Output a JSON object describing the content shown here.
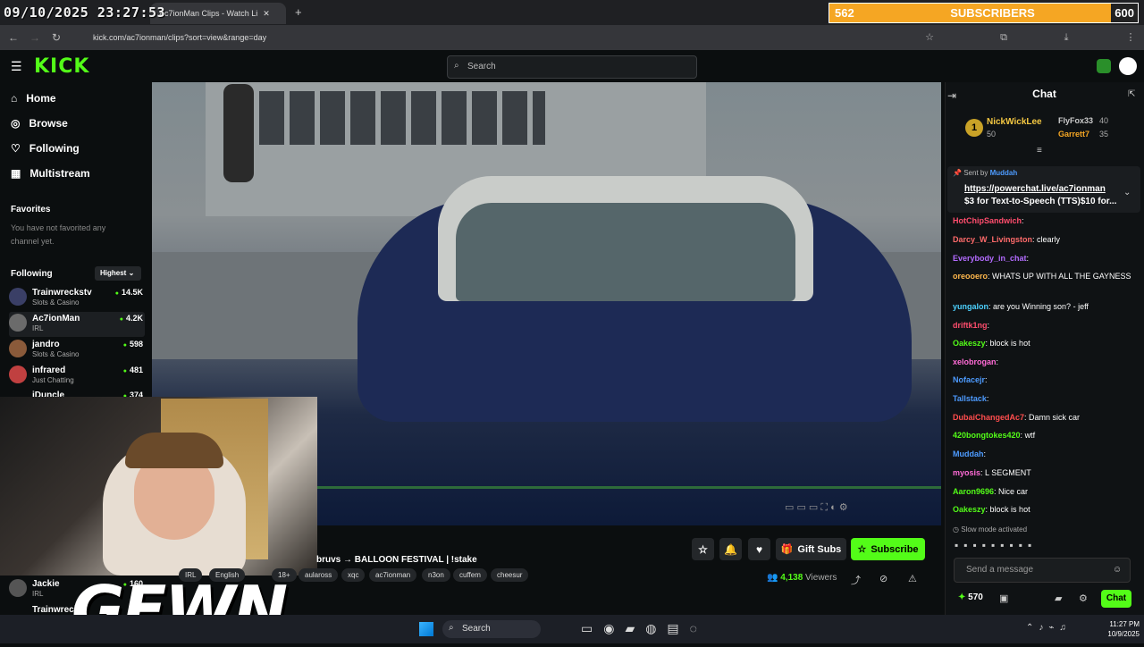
{
  "overlay": {
    "timestamp": "09/10/2025 23:27:53",
    "subs_current": "562",
    "subs_label": "SUBSCRIBERS",
    "subs_goal": "600",
    "watermark": "GEWN"
  },
  "browser": {
    "tab_title": "Ac7ionMan Clips - Watch Li",
    "url": "kick.com/ac7ionman/clips?sort=view&range=day"
  },
  "header": {
    "logo": "KICK",
    "search_placeholder": "Search"
  },
  "sidebar": {
    "nav": [
      {
        "label": "Home",
        "icon": "home-icon"
      },
      {
        "label": "Browse",
        "icon": "compass-icon"
      },
      {
        "label": "Following",
        "icon": "heart-icon"
      },
      {
        "label": "Multistream",
        "icon": "grid-icon"
      }
    ],
    "favorites_title": "Favorites",
    "favorites_empty": "You have not favorited any channel yet.",
    "following_title": "Following",
    "sort_label": "Highest",
    "channels": [
      {
        "name": "Trainwreckstv",
        "category": "Slots & Casino",
        "viewers": "14.5K"
      },
      {
        "name": "Ac7ionMan",
        "category": "IRL",
        "viewers": "4.2K"
      },
      {
        "name": "jandro",
        "category": "Slots & Casino",
        "viewers": "598"
      },
      {
        "name": "infrared",
        "category": "Just Chatting",
        "viewers": "481"
      },
      {
        "name": "iDuncle",
        "category": "",
        "viewers": "374"
      },
      {
        "name": "Jackie",
        "category": "IRL",
        "viewers": "160"
      },
      {
        "name": "Trainwreck",
        "category": "",
        "viewers": ""
      }
    ]
  },
  "stream": {
    "title": "bruvs → BALLOON FESTIVAL | !stake",
    "tags": [
      "IRL",
      "English",
      "18+",
      "aulaross",
      "xqc",
      "ac7ionman",
      "n3on",
      "cuffem",
      "cheesur"
    ],
    "viewers": "4,138",
    "viewers_label": "Viewers",
    "gift_label": "Gift Subs",
    "subscribe_label": "Subscribe"
  },
  "chat": {
    "title": "Chat",
    "leaders": [
      {
        "name": "NickWickLee",
        "score": "50"
      },
      {
        "name": "FlyFox33",
        "score": "40"
      },
      {
        "name": "Garrett7",
        "score": "35"
      }
    ],
    "pinned_sender_prefix": "Sent by",
    "pinned_sender": "Muddah",
    "pinned_link": "https://powerchat.live/ac7ionman",
    "pinned_text": "$3 for Text-to-Speech (TTS)$10 for...",
    "messages": [
      {
        "user": "HotChipSandwich",
        "text": "",
        "color": "#ff4d6d"
      },
      {
        "user": "Darcy_W_Livingston",
        "text": "clearly",
        "color": "#ff6b6b"
      },
      {
        "user": "Everybody_in_chat",
        "text": "",
        "color": "#b36bff"
      },
      {
        "user": "oreooero",
        "text": "WHATS UP WITH ALL THE GAYNESS",
        "color": "#ffb84d"
      },
      {
        "user": "yungalon",
        "text": "are you Winning son? - jeff",
        "color": "#4dd2ff"
      },
      {
        "user": "driftk1ng",
        "text": "",
        "color": "#ff4d6d"
      },
      {
        "user": "Oakeszy",
        "text": "block is hot",
        "color": "#53fc18"
      },
      {
        "user": "xelobrogan",
        "text": "",
        "color": "#ff6bd6"
      },
      {
        "user": "Nofacejr",
        "text": "",
        "color": "#4d9bff"
      },
      {
        "user": "Tallstack",
        "text": "",
        "color": "#4d9bff"
      },
      {
        "user": "DubaiChangedAc7",
        "text": "Damn sick car",
        "color": "#ff4d4d"
      },
      {
        "user": "420bongtokes420",
        "text": "wtf",
        "color": "#53fc18"
      },
      {
        "user": "Muddah",
        "text": "",
        "color": "#4d9bff"
      },
      {
        "user": "myosis",
        "text": "L SEGMENT",
        "color": "#ff6bd6"
      },
      {
        "user": "Aaron9696",
        "text": "Nice car",
        "color": "#53fc18"
      },
      {
        "user": "Oakeszy",
        "text": "block is hot",
        "color": "#53fc18"
      }
    ],
    "slow_mode": "Slow mode activated",
    "input_placeholder": "Send a message",
    "points": "570",
    "send_label": "Chat"
  },
  "taskbar": {
    "search_label": "Search",
    "time": "11:27 PM",
    "date": "10/9/2025"
  }
}
